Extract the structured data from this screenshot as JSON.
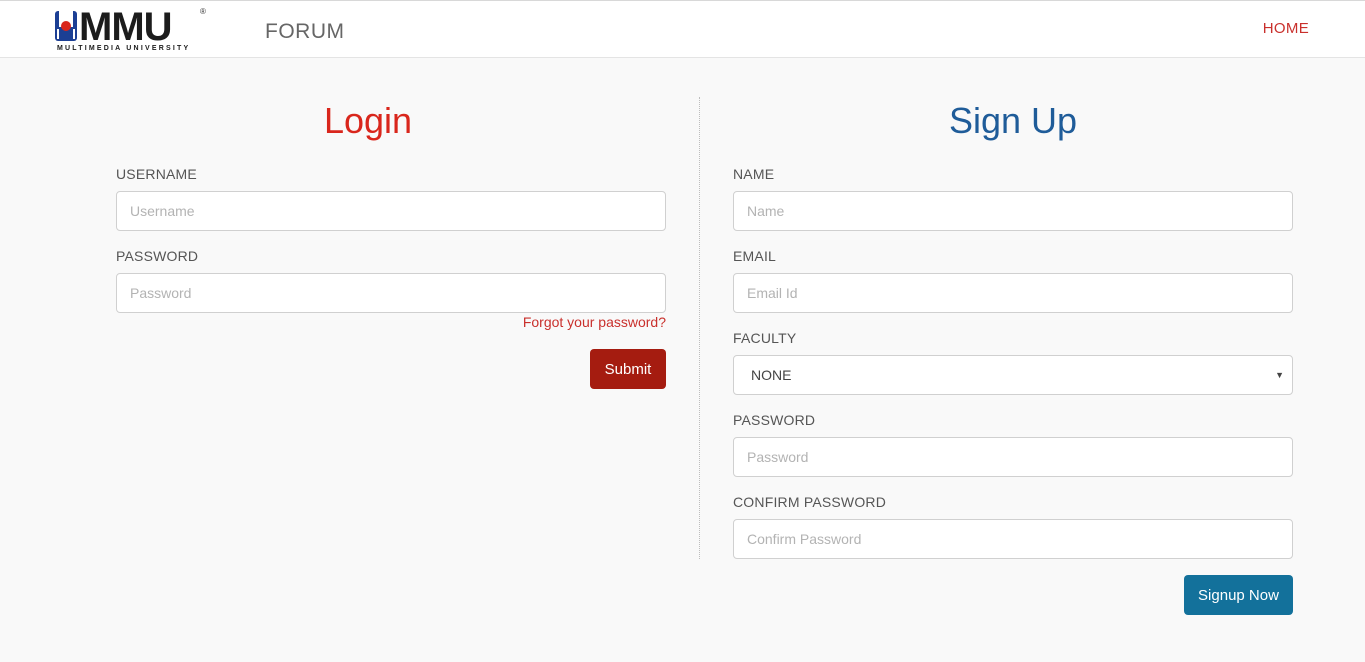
{
  "navbar": {
    "logo_text": "MMU",
    "logo_subtext": "MULTIMEDIA UNIVERSITY",
    "logo_registered": "®",
    "brand_suffix": "FORUM",
    "home_link": "HOME"
  },
  "login": {
    "title": "Login",
    "username_label": "USERNAME",
    "username_placeholder": "Username",
    "password_label": "PASSWORD",
    "password_placeholder": "Password",
    "forgot_link": "Forgot your password?",
    "submit_label": "Submit"
  },
  "signup": {
    "title": "Sign Up",
    "name_label": "NAME",
    "name_placeholder": "Name",
    "email_label": "EMAIL",
    "email_placeholder": "Email Id",
    "faculty_label": "FACULTY",
    "faculty_selected": "NONE",
    "password_label": "PASSWORD",
    "password_placeholder": "Password",
    "confirm_label": "CONFIRM PASSWORD",
    "confirm_placeholder": "Confirm Password",
    "submit_label": "Signup Now"
  },
  "colors": {
    "login_accent": "#d9261c",
    "signup_accent": "#1f5c99",
    "submit_button": "#a51c10",
    "signup_button": "#13719b"
  }
}
